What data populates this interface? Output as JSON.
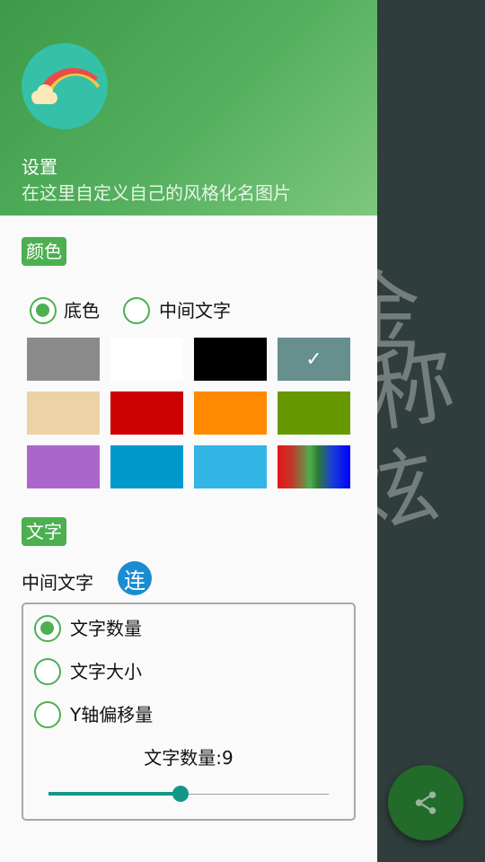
{
  "header": {
    "title": "设置",
    "subtitle": "在这里自定义自己的风格化名图片"
  },
  "color_section": {
    "badge": "颜色",
    "target_options": [
      {
        "label": "底色",
        "selected": true
      },
      {
        "label": "中间文字",
        "selected": false
      }
    ],
    "swatches": [
      {
        "color": "#8a8a8a",
        "selected": false
      },
      {
        "color": "#ffffff",
        "selected": false
      },
      {
        "color": "#000000",
        "selected": false
      },
      {
        "color": "#678f8e",
        "selected": true
      },
      {
        "color": "#ecd2a4",
        "selected": false
      },
      {
        "color": "#cc0000",
        "selected": false
      },
      {
        "color": "#ff8a00",
        "selected": false
      },
      {
        "color": "#669900",
        "selected": false
      },
      {
        "color": "#aa66cc",
        "selected": false
      },
      {
        "color": "#0099cc",
        "selected": false
      },
      {
        "color": "#33b5e5",
        "selected": false
      },
      {
        "color": "gradient-red-green-blue",
        "selected": false
      }
    ],
    "check_mark": "✓"
  },
  "text_section": {
    "badge": "文字",
    "field_label": "中间文字",
    "field_icon_text": "连",
    "options": [
      {
        "label": "文字数量",
        "selected": true
      },
      {
        "label": "文字大小",
        "selected": false
      },
      {
        "label": "Y轴偏移量",
        "selected": false
      }
    ],
    "count_label": "文字数量:9",
    "slider_value_fraction": 0.47
  },
  "background": {
    "glyphs": [
      "金",
      "称",
      "炫"
    ]
  },
  "fab": {
    "icon": "share-icon"
  },
  "colors": {
    "accent": "#4caf50",
    "slider": "#129786",
    "fab": "#226b2a"
  }
}
